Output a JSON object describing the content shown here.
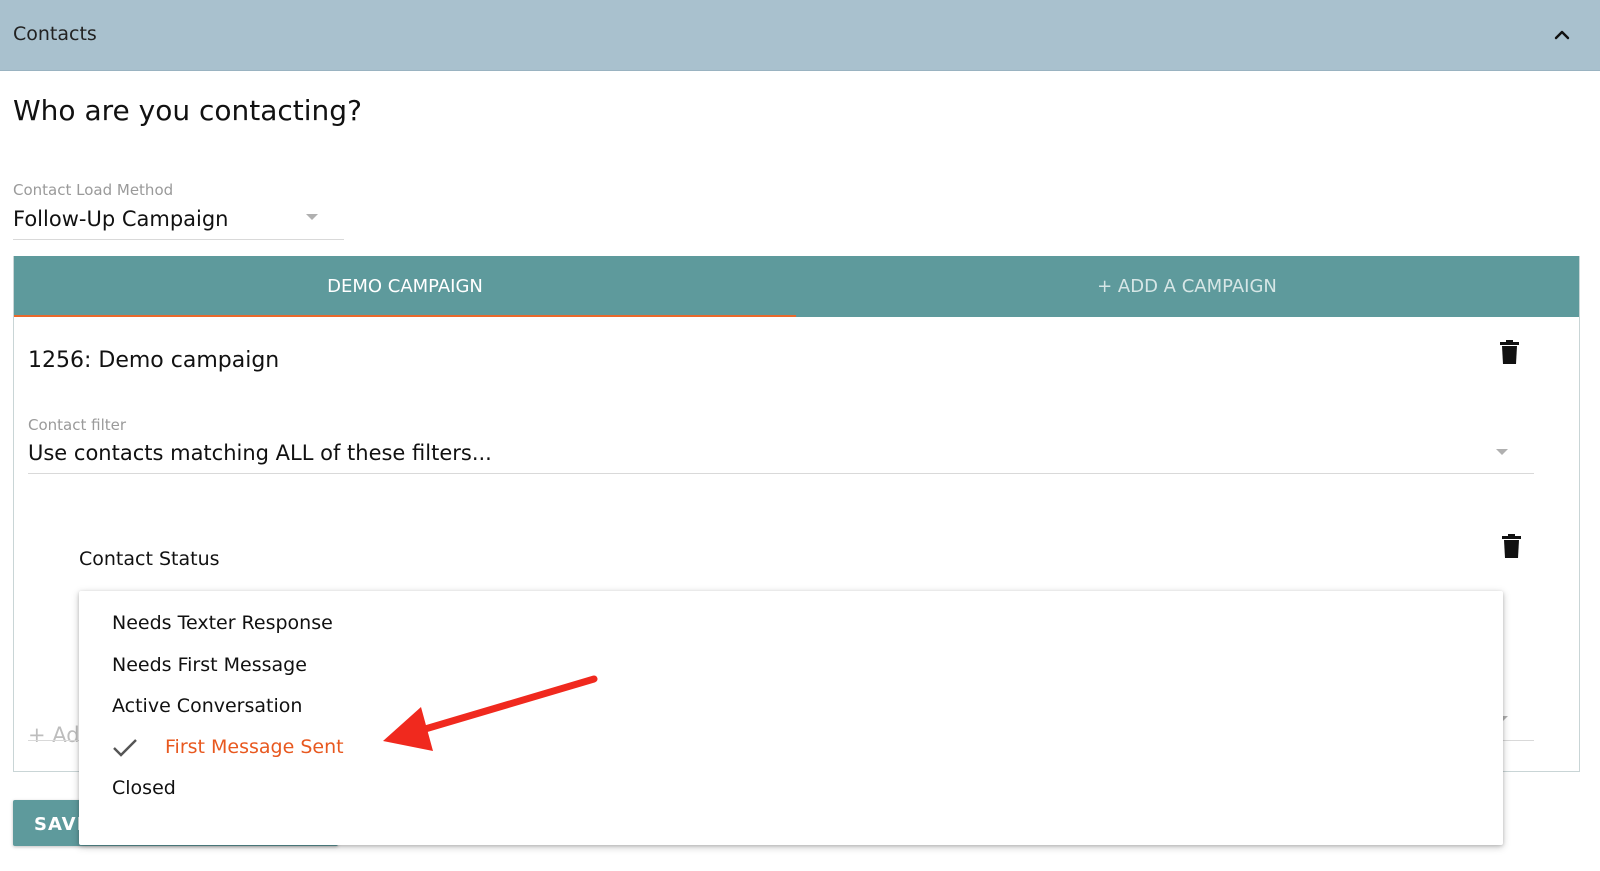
{
  "header": {
    "title": "Contacts",
    "collapse_icon": "chevron-up-icon"
  },
  "heading": "Who are you contacting?",
  "contact_load_method": {
    "label": "Contact Load Method",
    "value": "Follow-Up Campaign"
  },
  "tabs": [
    {
      "label": "DEMO CAMPAIGN",
      "active": true
    },
    {
      "label": "+ ADD A CAMPAIGN",
      "active": false
    }
  ],
  "campaign": {
    "title": "1256: Demo campaign",
    "delete_icon": "trash-icon"
  },
  "contact_filter": {
    "label": "Contact filter",
    "value": "Use contacts matching ALL of these filters..."
  },
  "filter_row": {
    "label": "Contact Status",
    "delete_icon": "trash-icon"
  },
  "add_filter_partial": "+ Add",
  "save_button_partial": "SAVE",
  "status_menu": {
    "items": [
      {
        "label": "Needs Texter Response",
        "selected": false
      },
      {
        "label": "Needs First Message",
        "selected": false
      },
      {
        "label": "Active Conversation",
        "selected": false
      },
      {
        "label": "First Message Sent",
        "selected": true
      },
      {
        "label": "Closed",
        "selected": false
      }
    ]
  },
  "colors": {
    "header_bg": "#a9c1ce",
    "teal_accent": "#5e9a9c",
    "tab_indicator": "#e9692c",
    "selected_text": "#e8581f",
    "annotation_arrow": "#f0291e"
  }
}
